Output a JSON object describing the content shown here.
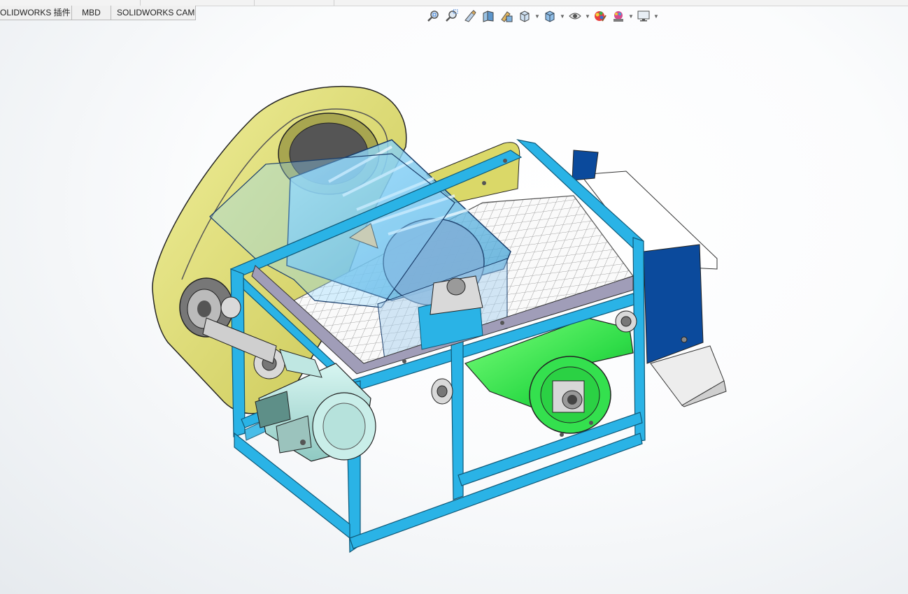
{
  "tabs": [
    {
      "label": "OLIDWORKS 插件"
    },
    {
      "label": "MBD"
    },
    {
      "label": "SOLIDWORKS CAM"
    }
  ],
  "toolbar": {
    "icons": [
      "zoom-to-fit-icon",
      "zoom-to-area-icon",
      "previous-view-icon",
      "section-view-icon",
      "dynamic-annotation-view-icon",
      "view-orientation-icon",
      "display-style-icon",
      "hide-show-items-icon",
      "edit-appearance-icon",
      "apply-scene-icon",
      "view-settings-icon"
    ]
  },
  "colors": {
    "frame": "#2ab3e6",
    "frame_dark": "#1b7fa8",
    "belt_guard": "#e0df6a",
    "roller": "#3ee85a",
    "drum_glass": "#66c6f0",
    "chute_blue": "#0b4a9c",
    "mesh": "#f4f4f4"
  }
}
